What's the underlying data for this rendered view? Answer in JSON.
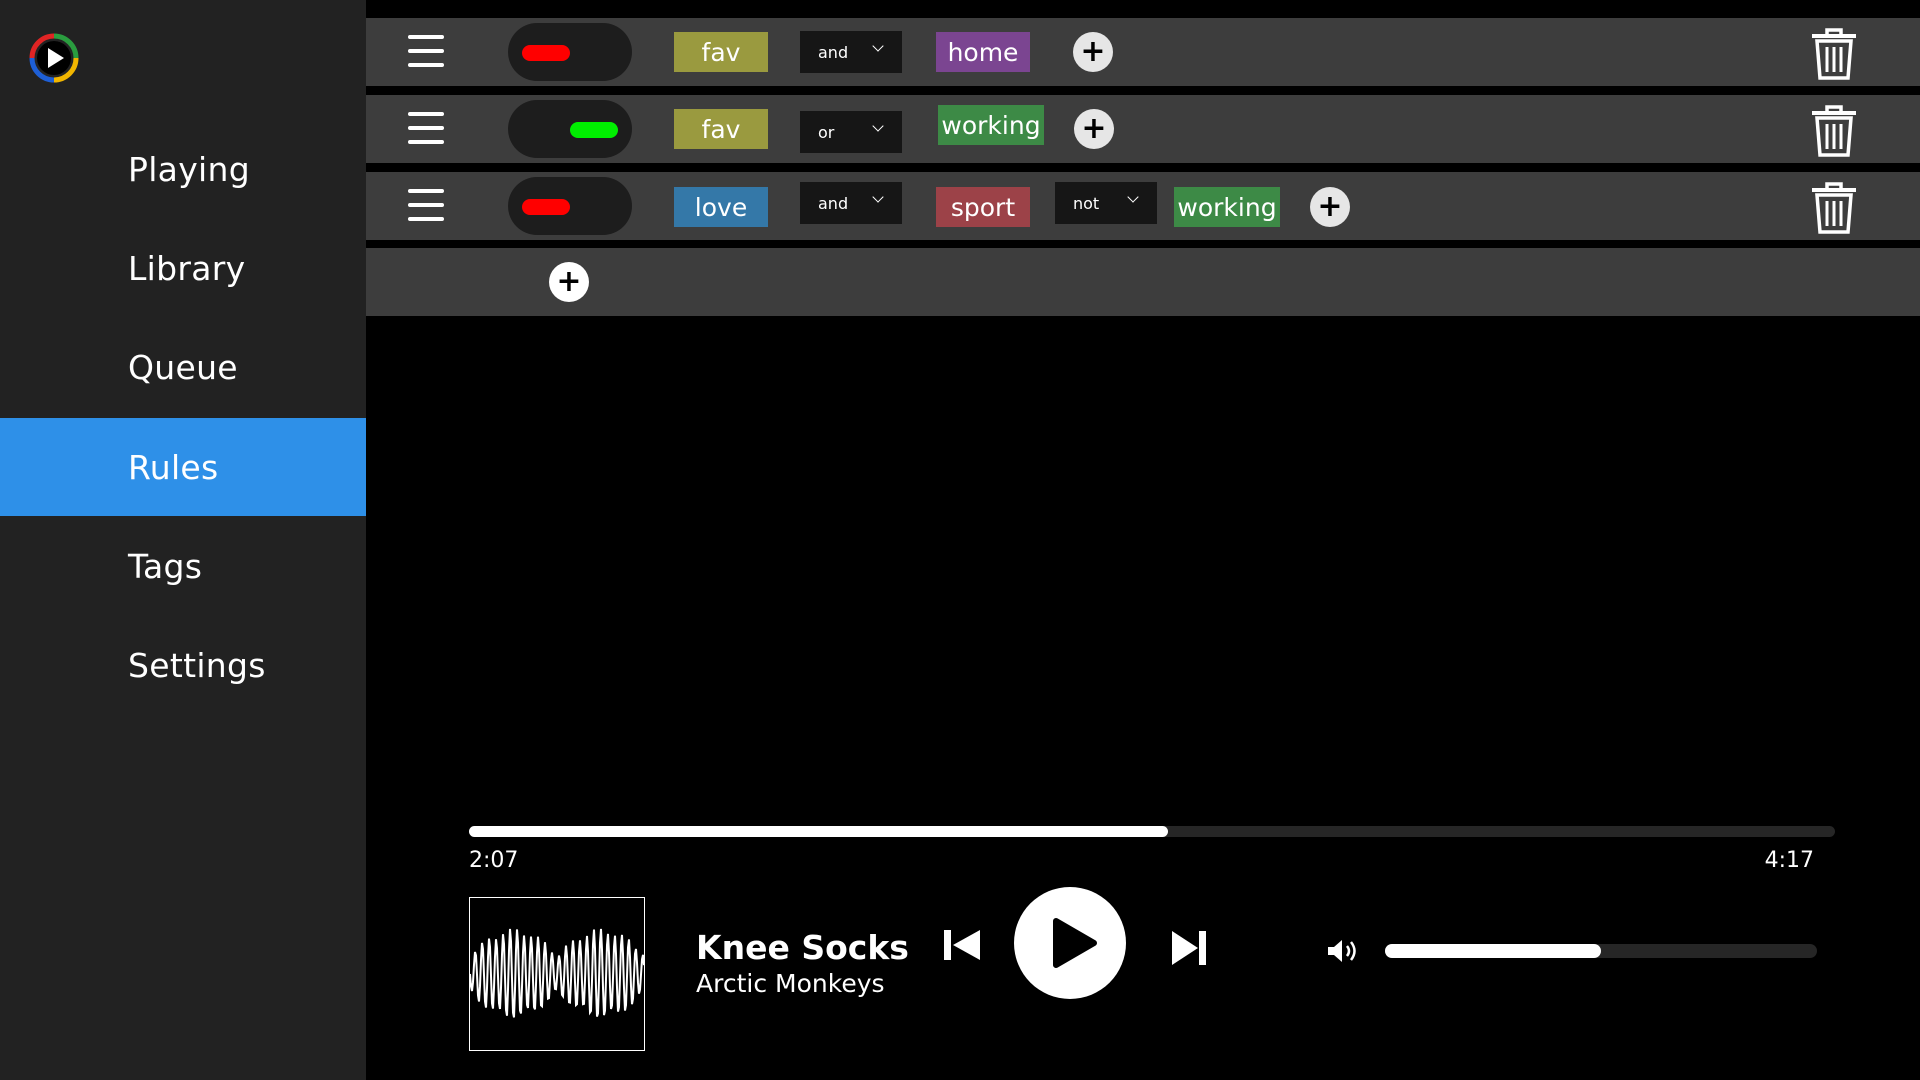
{
  "sidebar": {
    "items": [
      {
        "label": "Playing"
      },
      {
        "label": "Library"
      },
      {
        "label": "Queue"
      },
      {
        "label": "Rules",
        "active": true
      },
      {
        "label": "Tags"
      },
      {
        "label": "Settings"
      }
    ],
    "accent": "#2e90e8"
  },
  "rules": [
    {
      "enabled": false,
      "tag1": {
        "label": "fav",
        "color": "#9a9a3f"
      },
      "op1": "and",
      "tag2": {
        "label": "home",
        "color": "#7b4591"
      }
    },
    {
      "enabled": true,
      "tag1": {
        "label": "fav",
        "color": "#9a9a3f"
      },
      "op1": "or",
      "tag2": {
        "label": "working",
        "color": "#3d8a46"
      }
    },
    {
      "enabled": false,
      "tag1": {
        "label": "love",
        "color": "#3478a8"
      },
      "op1": "and",
      "tag2": {
        "label": "sport",
        "color": "#9c4248"
      },
      "op2": "not",
      "tag3": {
        "label": "working",
        "color": "#3d8a46"
      }
    }
  ],
  "icons": {
    "menu": "hamburger-icon",
    "add": "plus-icon",
    "delete": "trash-icon",
    "prev": "skip-previous-icon",
    "play": "play-icon",
    "next": "skip-next-icon",
    "volume": "volume-icon"
  },
  "player": {
    "elapsed": "2:07",
    "duration": "4:17",
    "progress": 0.512,
    "title": "Knee Socks",
    "artist": "Arctic Monkeys",
    "volume": 0.5
  }
}
